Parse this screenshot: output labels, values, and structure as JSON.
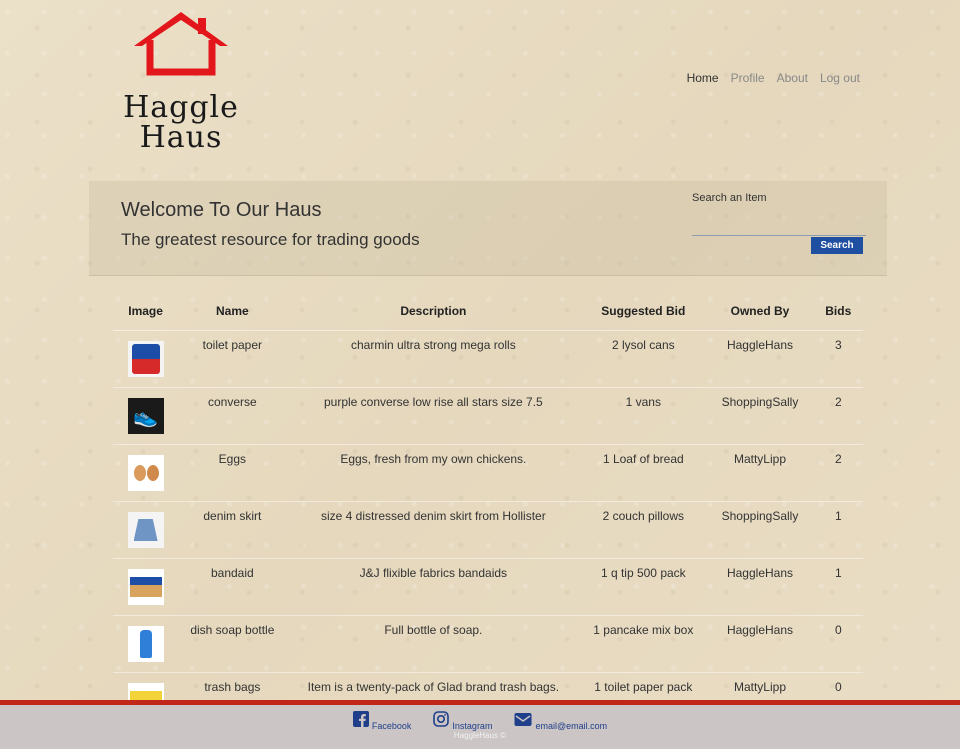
{
  "brand": {
    "line1": "Haggle",
    "line2": "Haus",
    "logo_icon": "house-icon",
    "logo_color": "#e3161b"
  },
  "nav": [
    {
      "label": "Home"
    },
    {
      "label": "Profile"
    },
    {
      "label": "About"
    },
    {
      "label": "Log out"
    }
  ],
  "hero": {
    "title": "Welcome To Our Haus",
    "subtitle": "The greatest resource for trading goods"
  },
  "search": {
    "label": "Search an Item",
    "value": "",
    "button": "Search"
  },
  "table": {
    "headers": [
      "Image",
      "Name",
      "Description",
      "Suggested Bid",
      "Owned By",
      "Bids"
    ],
    "rows": [
      {
        "image_icon": "toilet-paper-icon",
        "name": "toilet paper",
        "description": "charmin ultra strong mega rolls",
        "bid": "2 lysol cans",
        "owner": "HaggleHans",
        "bids": "3"
      },
      {
        "image_icon": "sneakers-icon",
        "name": "converse",
        "description": "purple converse low rise all stars size 7.5",
        "bid": "1 vans",
        "owner": "ShoppingSally",
        "bids": "2"
      },
      {
        "image_icon": "eggs-icon",
        "name": "Eggs",
        "description": "Eggs, fresh from my own chickens.",
        "bid": "1 Loaf of bread",
        "owner": "MattyLipp",
        "bids": "2"
      },
      {
        "image_icon": "denim-skirt-icon",
        "name": "denim skirt",
        "description": "size 4 distressed denim skirt from Hollister",
        "bid": "2 couch pillows",
        "owner": "ShoppingSally",
        "bids": "1"
      },
      {
        "image_icon": "bandaid-box-icon",
        "name": "bandaid",
        "description": "J&J flixible fabrics bandaids",
        "bid": "1 q tip 500 pack",
        "owner": "HaggleHans",
        "bids": "1"
      },
      {
        "image_icon": "soap-bottle-icon",
        "name": "dish soap bottle",
        "description": "Full bottle of soap.",
        "bid": "1 pancake mix box",
        "owner": "HaggleHans",
        "bids": "0"
      },
      {
        "image_icon": "trash-bags-icon",
        "name": "trash bags",
        "description": "Item is a twenty-pack of Glad brand trash bags.",
        "bid": "1 toilet paper pack",
        "owner": "MattyLipp",
        "bids": "0"
      }
    ]
  },
  "footer": {
    "facebook": "Facebook",
    "instagram": "Instagram",
    "email": "email@email.com",
    "copyright": "HaggleHaus ©",
    "accent": "#c0261a"
  }
}
